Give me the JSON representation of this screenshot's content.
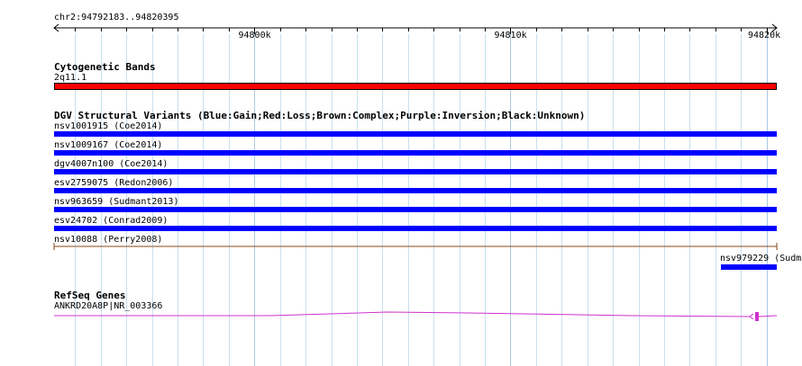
{
  "browser": {
    "region": "chr2:94792183..94820395",
    "ruler": {
      "start": 94792183,
      "end": 94820395,
      "ticks": [
        {
          "pos": 94800000,
          "label": "94800k"
        },
        {
          "pos": 94810000,
          "label": "94810k"
        },
        {
          "pos": 94820000,
          "label": "94820k"
        }
      ]
    },
    "colors": {
      "cyto_band": "#ff0000",
      "gain": "#0000ff",
      "loss_or_line": "#8b4513",
      "refseq": "#cc33cc",
      "grid": "#c8e0f0"
    }
  },
  "tracks": {
    "cytoband": {
      "title": "Cytogenetic Bands",
      "band": "2q11.1"
    },
    "dgv": {
      "title": "DGV Structural Variants (Blue:Gain;Red:Loss;Brown:Complex;Purple:Inversion;Black:Unknown)",
      "features": [
        {
          "label": "nsv1001915 (Coe2014)",
          "type": "gain"
        },
        {
          "label": "nsv1009167 (Coe2014)",
          "type": "gain"
        },
        {
          "label": "dgv4007n100 (Coe2014)",
          "type": "gain"
        },
        {
          "label": "esv2759075 (Redon2006)",
          "type": "gain"
        },
        {
          "label": "nsv963659 (Sudmant2013)",
          "type": "gain"
        },
        {
          "label": "esv24702 (Conrad2009)",
          "type": "gain"
        },
        {
          "label": "nsv10088 (Perry2008)",
          "type": "complex"
        },
        {
          "label": "nsv979229 (Sudm",
          "type": "gain"
        }
      ]
    },
    "refseq": {
      "title": "RefSeq Genes",
      "gene": "ANKRD20A8P|NR_003366"
    }
  }
}
